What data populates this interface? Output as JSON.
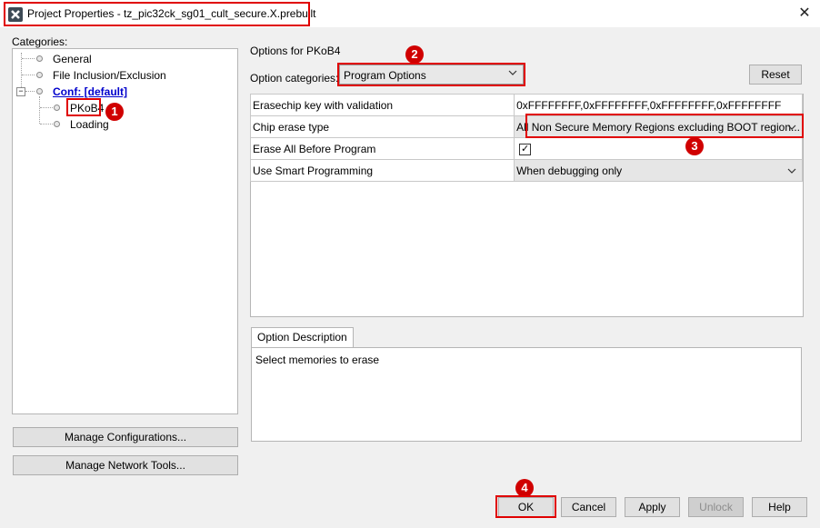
{
  "window": {
    "title": "Project Properties - tz_pic32ck_sg01_cult_secure.X.prebuilt",
    "close_glyph": "✕"
  },
  "categories": {
    "label": "Categories:",
    "items": [
      {
        "label": "General"
      },
      {
        "label": "File Inclusion/Exclusion"
      },
      {
        "label": "Conf: [default]"
      },
      {
        "label": "PKoB4"
      },
      {
        "label": "Loading"
      }
    ]
  },
  "left_buttons": {
    "manage_configurations": "Manage Configurations...",
    "manage_network_tools": "Manage Network Tools..."
  },
  "options": {
    "header": "Options for PKoB4",
    "category_label": "Option categories:",
    "category_value": "Program Options",
    "reset_label": "Reset",
    "rows": [
      {
        "name": "Erasechip key with validation",
        "value": "0xFFFFFFFF,0xFFFFFFFF,0xFFFFFFFF,0xFFFFFFFF"
      },
      {
        "name": "Chip erase type",
        "value": "All Non Secure Memory Regions excluding BOOT region..."
      },
      {
        "name": "Erase All Before Program",
        "value": "✓"
      },
      {
        "name": "Use Smart Programming",
        "value": "When debugging only"
      }
    ]
  },
  "description": {
    "tab_label": "Option Description",
    "text": "Select memories to erase"
  },
  "footer": {
    "ok": "OK",
    "cancel": "Cancel",
    "apply": "Apply",
    "unlock": "Unlock",
    "help": "Help"
  },
  "annotations": [
    "1",
    "2",
    "3",
    "4"
  ],
  "colors": {
    "highlight": "#e00000",
    "link": "#0000cc",
    "background": "#f0f0f0"
  }
}
